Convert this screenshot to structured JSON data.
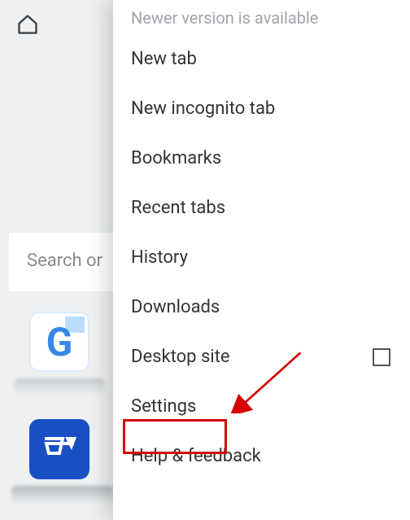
{
  "home_icon": "home-icon",
  "background": {
    "search_placeholder": "Search or",
    "tiles": [
      {
        "id": "g",
        "letter": "G"
      },
      {
        "id": "e",
        "letter": ""
      }
    ]
  },
  "menu": {
    "banner": "Newer version is available",
    "items": [
      {
        "id": "new-tab",
        "label": "New tab"
      },
      {
        "id": "new-incognito",
        "label": "New incognito tab"
      },
      {
        "id": "bookmarks",
        "label": "Bookmarks"
      },
      {
        "id": "recent-tabs",
        "label": "Recent tabs"
      },
      {
        "id": "history",
        "label": "History"
      },
      {
        "id": "downloads",
        "label": "Downloads"
      },
      {
        "id": "desktop-site",
        "label": "Desktop site",
        "checkbox": true,
        "checked": false
      },
      {
        "id": "settings",
        "label": "Settings",
        "highlighted": true
      },
      {
        "id": "help-feedback",
        "label": "Help & feedback"
      }
    ]
  },
  "annotation": {
    "highlight_target": "settings",
    "arrow_color": "#d60000"
  }
}
